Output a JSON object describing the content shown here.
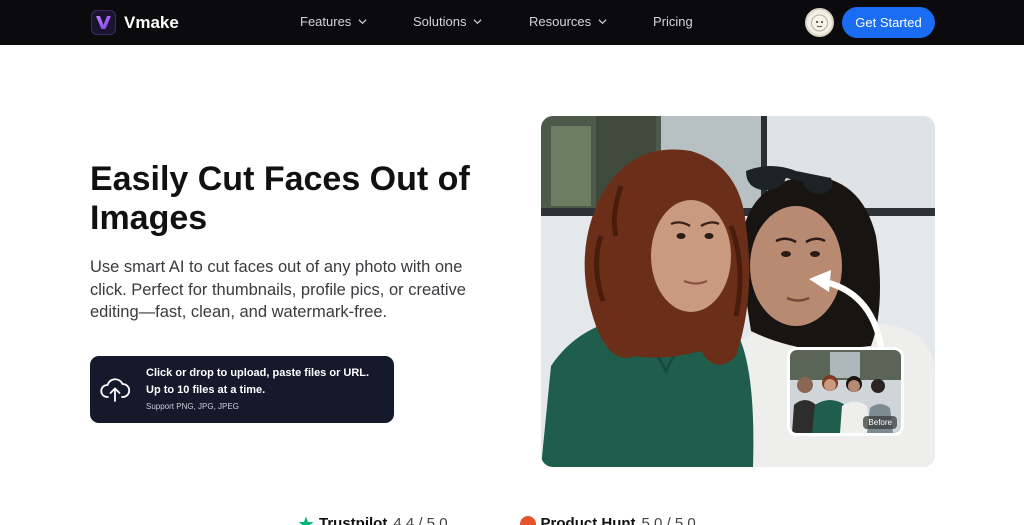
{
  "nav": {
    "brand": "Vmake",
    "items": [
      {
        "label": "Features",
        "has_dropdown": true
      },
      {
        "label": "Solutions",
        "has_dropdown": true
      },
      {
        "label": "Resources",
        "has_dropdown": true
      },
      {
        "label": "Pricing",
        "has_dropdown": false
      }
    ],
    "cta_label": "Get Started"
  },
  "hero": {
    "title": "Easily Cut Faces Out of Images",
    "subtitle": "Use smart AI to cut faces out of any photo with one click. Perfect for thumbnails, profile pics, or creative editing—fast, clean, and watermark-free.",
    "upload": {
      "line1": "Click or drop to upload, paste files or URL.",
      "line2": "Up to 10 files at a time.",
      "formats": "Support PNG, JPG, JPEG"
    },
    "before_label": "Before"
  },
  "ratings": [
    {
      "name": "Trustpilot",
      "score": "4.4 / 5.0"
    },
    {
      "name": "Product Hunt",
      "score": "5.0 / 5.0"
    }
  ],
  "colors": {
    "nav_bg": "#0b0b0d",
    "cta": "#1a6cf2",
    "upload_bg": "#141a2c",
    "brand_purple": "#8b5cf6"
  }
}
